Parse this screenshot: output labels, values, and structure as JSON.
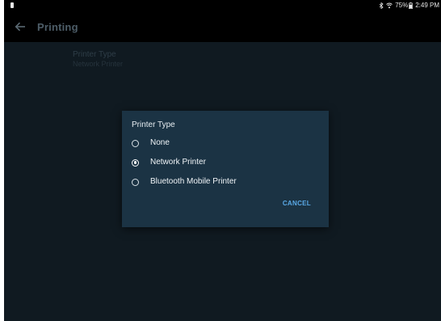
{
  "status_bar": {
    "battery_text": "75%",
    "time": "2:49 PM"
  },
  "app_bar": {
    "title": "Printing"
  },
  "setting": {
    "title": "Printer Type",
    "value": "Network Printer"
  },
  "dialog": {
    "title": "Printer Type",
    "options": [
      {
        "label": "None",
        "selected": false
      },
      {
        "label": "Network Printer",
        "selected": true
      },
      {
        "label": "Bluetooth Mobile Printer",
        "selected": false
      }
    ],
    "cancel_label": "CANCEL"
  },
  "colors": {
    "background": "#101a21",
    "app_bar": "#000000",
    "dialog": "#1b3344",
    "accent": "#5aa9e6"
  }
}
